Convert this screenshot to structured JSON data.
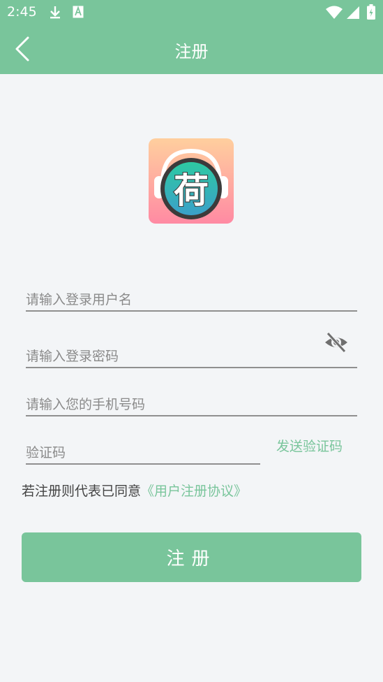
{
  "status_bar": {
    "time": "2:45",
    "icons": [
      "download-icon",
      "a-notification-icon",
      "wifi-icon",
      "signal-icon",
      "battery-icon"
    ]
  },
  "header": {
    "title": "注册",
    "back_icon": "back-arrow-icon"
  },
  "logo": {
    "text": "荷",
    "icon": "app-logo-headphones"
  },
  "form": {
    "username_placeholder": "请输入登录用户名",
    "password_placeholder": "请输入登录密码",
    "phone_placeholder": "请输入您的手机号码",
    "code_placeholder": "验证码",
    "send_code_label": "发送验证码",
    "agreement_prefix": "若注册则代表已同意",
    "agreement_link": "《用户注册协议》",
    "submit_label": "注册"
  },
  "colors": {
    "accent": "#79c59b",
    "background": "#f3f5f7",
    "underline": "#8f8f8f"
  }
}
